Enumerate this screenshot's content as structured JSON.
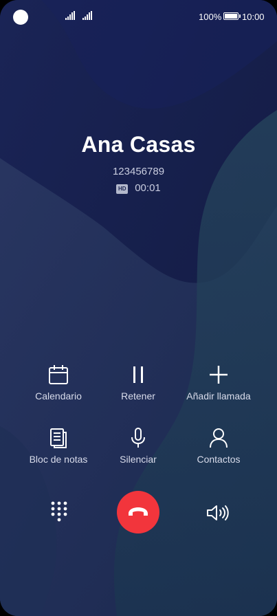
{
  "status_bar": {
    "battery_percent": "100%",
    "time": "10:00"
  },
  "call": {
    "caller_name": "Ana Casas",
    "number": "123456789",
    "hd_badge": "HD",
    "duration": "00:01"
  },
  "actions": [
    {
      "label": "Calendario",
      "icon": "calendar-icon"
    },
    {
      "label": "Retener",
      "icon": "pause-icon"
    },
    {
      "label": "Añadir llamada",
      "icon": "plus-icon"
    },
    {
      "label": "Bloc de notas",
      "icon": "notes-icon"
    },
    {
      "label": "Silenciar",
      "icon": "microphone-icon"
    },
    {
      "label": "Contactos",
      "icon": "person-icon"
    }
  ],
  "bottom_controls": {
    "keypad": "dialpad-icon",
    "end_call": "end-call-icon",
    "speaker": "speaker-icon"
  },
  "colors": {
    "background": "#15204a",
    "end_call": "#f2353c"
  }
}
